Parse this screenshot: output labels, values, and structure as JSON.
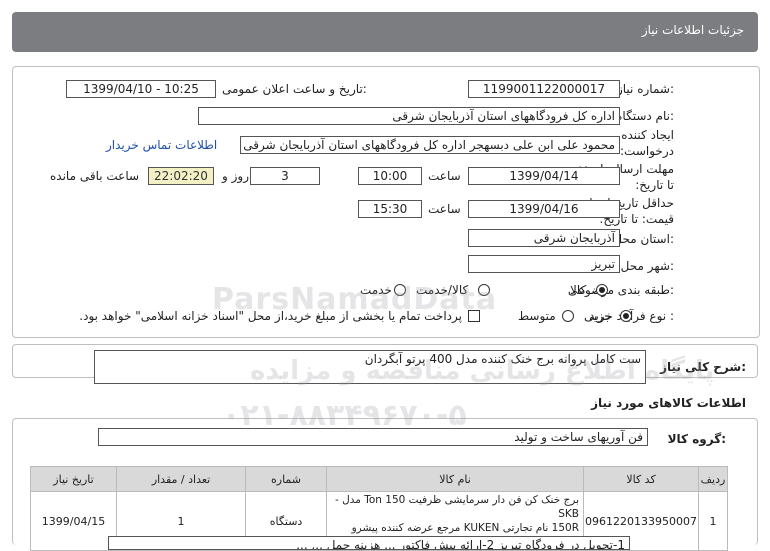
{
  "window": {
    "title": "جزئیات اطلاعات نیاز"
  },
  "form": {
    "need_number": {
      "label": "شماره نیاز:",
      "value": "1199001122000017"
    },
    "announce_datetime": {
      "label": "تاریخ و ساعت اعلان عمومی:",
      "value": "1399/04/10 - 10:25"
    },
    "buyer_org": {
      "label": "نام دستگاه خریدار:",
      "value": "اداره کل فرودگاههای استان آذربایجان شرقی"
    },
    "requester": {
      "label_line1": "ایجاد کننده",
      "label_line2": "درخواست:",
      "value": "محمود علی ابن علی دبسهجر اداره کل فرودگاههای استان آذربایجان شرقی"
    },
    "contact_link": "اطلاعات تماس خریدار",
    "send_deadline": {
      "label_line1": "مهلت ارسال پاسخ:",
      "label_line2": "تا تاریخ:",
      "date": "1399/04/14",
      "time_label": "ساعت",
      "time": "10:00",
      "days": "3",
      "days_label": "روز و",
      "remaining": "22:02:20",
      "remaining_label": "ساعت باقی مانده"
    },
    "price_validity": {
      "label_line1": "حداقل تاریخ اعتبار",
      "label_line2": "قیمت: تا تاریخ:",
      "date": "1399/04/16",
      "time_label": "ساعت",
      "time": "15:30"
    },
    "delivery_province": {
      "label": "استان محل تحویل:",
      "value": "آذربایجان شرقی"
    },
    "delivery_city": {
      "label": "شهر محل تحویل:",
      "value": "تبریز"
    },
    "category": {
      "label": "طبقه بندی موضوعی:",
      "options": [
        "کالا",
        "کالا/خدمت",
        "خدمت"
      ],
      "selected": "کالا"
    },
    "purchase_process": {
      "label": "نوع فرآیند خرید :",
      "options": [
        "جزیی",
        "متوسط"
      ],
      "selected": "جزیی",
      "checkbox_text": "پرداخت تمام یا بخشی از مبلغ خرید،از محل \"اسناد خزانه اسلامی\" خواهد بود."
    }
  },
  "summary": {
    "label": "شرح کلی نیاز:",
    "value": "ست کامل پروانه برج خنک کننده مدل 400 پرتو آبگردان"
  },
  "goods_section_title": "اطلاعات کالاهای مورد نیاز",
  "goods_group": {
    "label": "گروه کالا:",
    "value": "فن آوریهای ساخت و تولید"
  },
  "table": {
    "headers": [
      "ردیف",
      "کد کالا",
      "نام کالا",
      "شماره",
      "تعداد / مقدار",
      "تاریخ نیاز"
    ],
    "rows": [
      {
        "row": "1",
        "code": "0961220133950007",
        "name_line1": "برج خنک کن فن دار سرمایشی ظرفیت 150 Ton مدل -SKB",
        "name_line2": "150R نام تجارتی KUKEN مرجع عرضه کننده پیشرو تهویه نیا",
        "unit": "دستگاه",
        "qty": "1",
        "date": "1399/04/15"
      }
    ]
  },
  "watermark": {
    "brand": "ParsNamadData",
    "line1": "پایگاه اطلاع رسانی مناقصه و مزایده",
    "phone": "۰۲۱-۸۸۳۴۹۶۷۰-۵"
  },
  "footer_snippet": "1-تحویل در فرودگاه تبریز 2-ارائه پیش فاکتور ... هزینه حمل ... ..."
}
